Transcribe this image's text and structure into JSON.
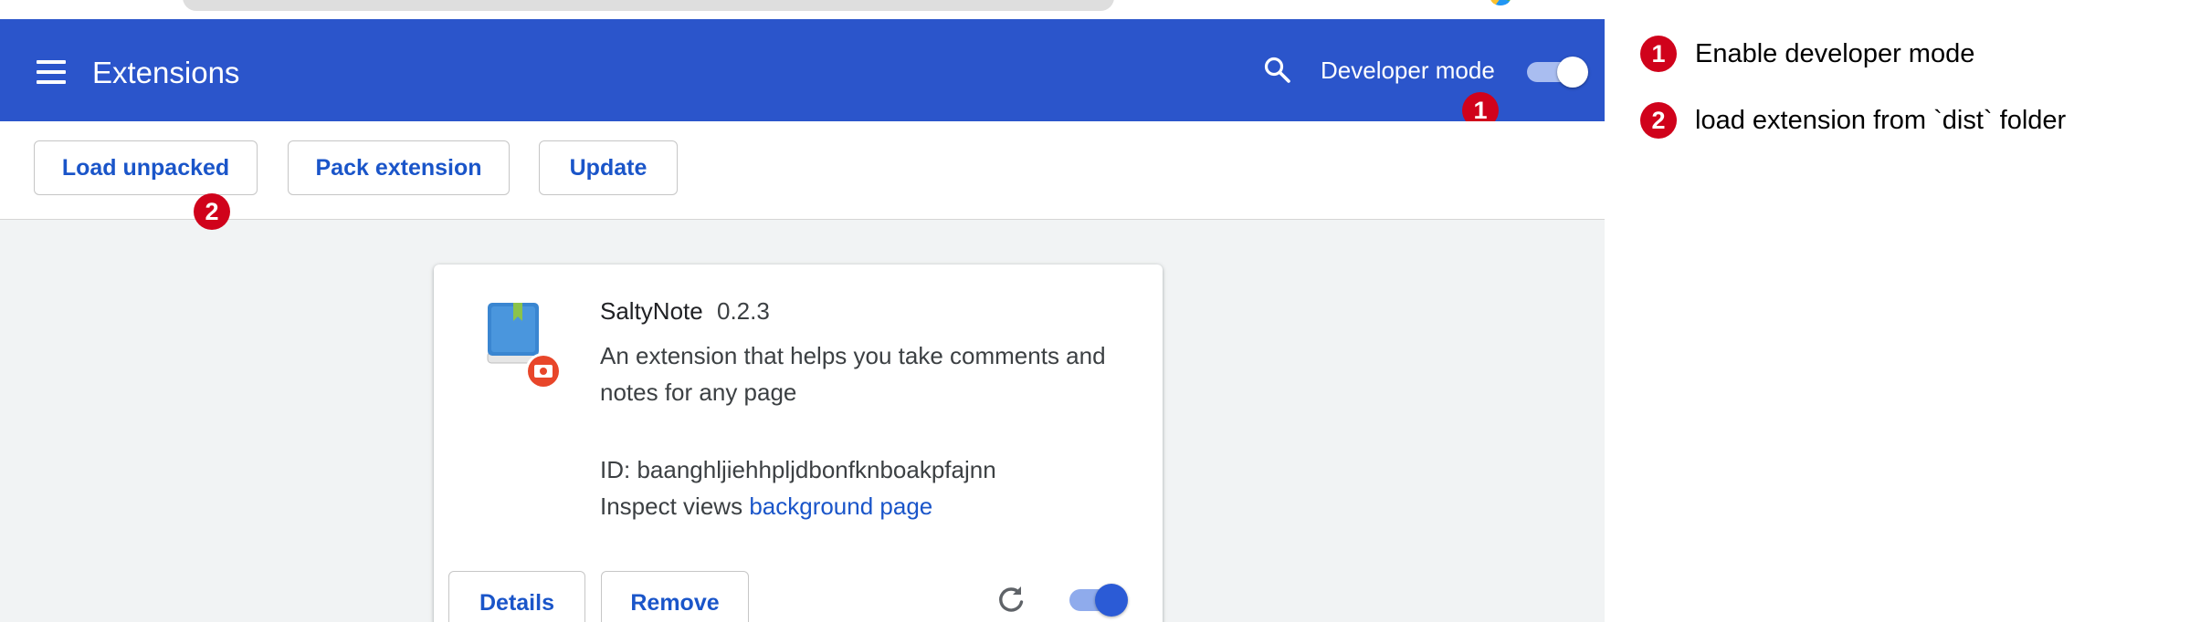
{
  "header": {
    "title": "Extensions",
    "menu_icon": "hamburger-menu-icon",
    "search_icon": "search-icon",
    "developer_mode_label": "Developer mode",
    "developer_mode_enabled": true
  },
  "toolbar": {
    "load_unpacked_label": "Load unpacked",
    "pack_extension_label": "Pack extension",
    "update_label": "Update"
  },
  "extension": {
    "name": "SaltyNote",
    "version": "0.2.3",
    "description": "An extension that helps you take comments and notes for any page",
    "id_text": "ID: baanghljiehhpljdbonfknboakpfajnn",
    "inspect_views_label": "Inspect views",
    "inspect_link": "background page",
    "details_label": "Details",
    "remove_label": "Remove",
    "reload_icon": "reload-icon",
    "enabled": true
  },
  "annotations": [
    {
      "number": "1",
      "text": "Enable developer mode"
    },
    {
      "number": "2",
      "text": "load extension from `dist` folder"
    }
  ],
  "colors": {
    "header_blue": "#2b55cb",
    "link_blue": "#1a55c9",
    "badge_red": "#d0021b"
  }
}
